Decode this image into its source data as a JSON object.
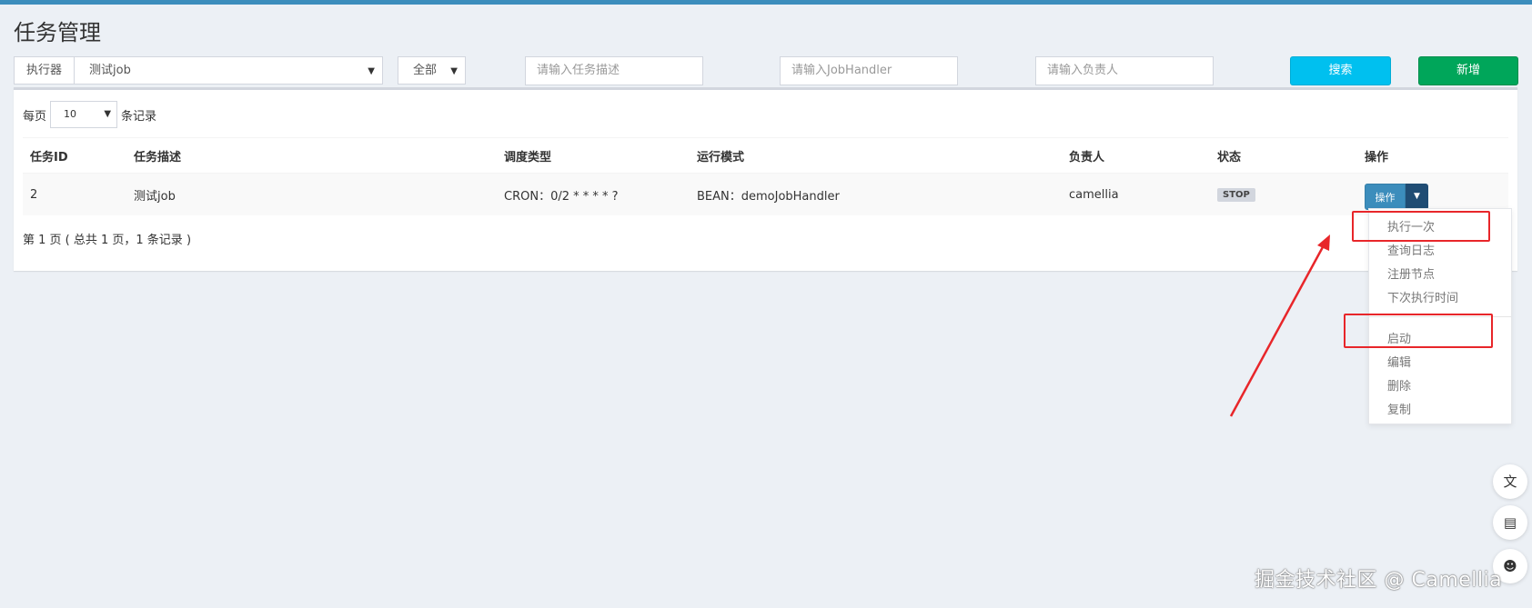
{
  "header": {
    "title": "任务管理"
  },
  "filters": {
    "executor_label": "执行器",
    "executor_value": "测试job",
    "status_value": "全部",
    "desc_placeholder": "请输入任务描述",
    "handler_placeholder": "请输入JobHandler",
    "owner_placeholder": "请输入负责人",
    "search_label": "搜索",
    "add_label": "新增"
  },
  "table_controls": {
    "per_page_prefix": "每页",
    "per_page_value": "10",
    "per_page_suffix": "条记录"
  },
  "table": {
    "columns": [
      "任务ID",
      "任务描述",
      "调度类型",
      "运行模式",
      "负责人",
      "状态",
      "操作"
    ],
    "rows": [
      {
        "id": "2",
        "desc": "测试job",
        "schedule": "CRON：0/2 * * * * ?",
        "mode": "BEAN：demoJobHandler",
        "owner": "camellia",
        "status": "STOP",
        "action_label": "操作"
      }
    ]
  },
  "pagination": {
    "info": "第 1 页 ( 总共 1 页，1 条记录 )"
  },
  "action_menu": {
    "items": [
      "执行一次",
      "查询日志",
      "注册节点",
      "下次执行时间",
      "启动",
      "编辑",
      "删除",
      "复制"
    ]
  },
  "watermark": "掘金技术社区 @ Camellia",
  "colors": {
    "top_bar": "#3c8dbc",
    "search_button": "#00c0ef",
    "add_button": "#00a65a",
    "action_button": "#3c8dbc",
    "annotation": "#e8262a"
  },
  "icons": [
    "translate-icon",
    "reader-icon",
    "assistant-icon"
  ]
}
